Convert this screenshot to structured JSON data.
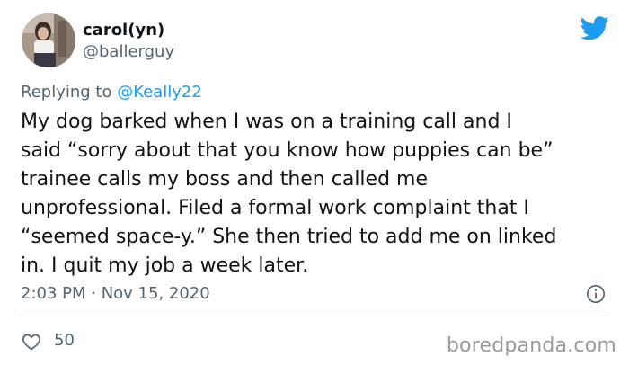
{
  "user": {
    "display_name": "carol(yn)",
    "handle": "@ballerguy",
    "avatar": "profile-photo"
  },
  "reply": {
    "prefix": "Replying to",
    "mention": "@Keally22"
  },
  "tweet": {
    "lines": [
      "My dog barked when I was on a training call and I",
      "said “sorry about that you know how puppies can be”",
      "trainee calls my boss and then called me",
      "unprofessional. Filed a formal work complaint that I",
      "“seemed space-y.” She then tried to add me on linked",
      "in. I quit my job a week later."
    ]
  },
  "meta": {
    "timestamp": "2:03 PM · Nov 15, 2020"
  },
  "stats": {
    "likes": "50"
  },
  "icons": {
    "brand": "twitter-bird-icon",
    "info": "info-icon",
    "like": "heart-icon"
  },
  "colors": {
    "brand_blue": "#1d9bf0",
    "text_primary": "#0f1419",
    "text_secondary": "#536471",
    "watermark": "#9a9a9a"
  },
  "watermark": "boredpanda.com"
}
